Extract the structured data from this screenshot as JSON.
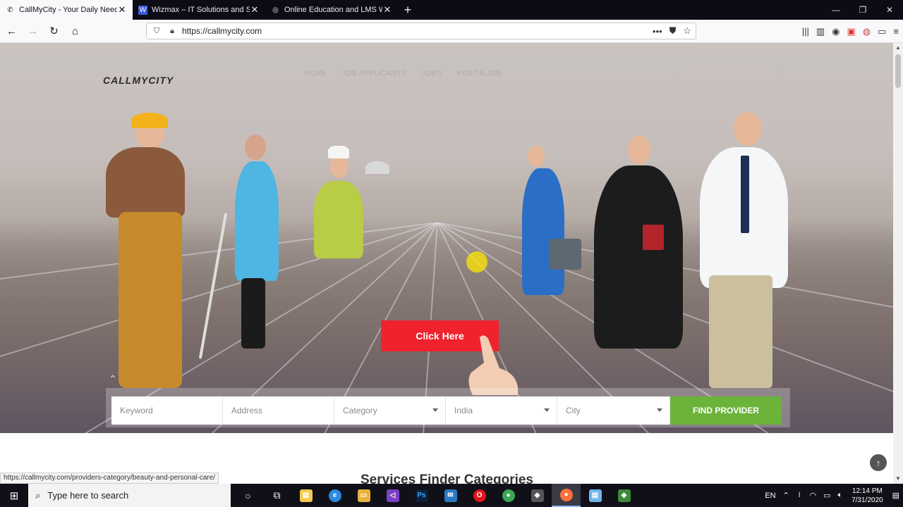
{
  "browser": {
    "tabs": [
      {
        "title": "CallMyCity - Your Daily Needs Fulfi",
        "active": true
      },
      {
        "title": "Wizmax – IT Solutions and Ser",
        "active": false
      },
      {
        "title": "Online Education and LMS Wo",
        "active": false
      }
    ],
    "url": "https://callmycity.com",
    "status_url": "https://callmycity.com/providers-category/beauty-and-personal-care/"
  },
  "site": {
    "logo": "CALLMYCITY",
    "menu": [
      "HOME",
      "JOB APPLICANTS",
      "JOBS",
      "POST A JOB"
    ],
    "hero_button": "Click Here",
    "search": {
      "keyword_placeholder": "Keyword",
      "address_placeholder": "Address",
      "category_value": "Category",
      "country_value": "India",
      "city_value": "City",
      "find_label": "FIND PROVIDER"
    },
    "section_title": "Services Finder Categories"
  },
  "taskbar": {
    "search_placeholder": "Type here to search",
    "language": "EN",
    "time": "12:14 PM",
    "date": "7/31/2020"
  },
  "colors": {
    "accent_red": "#f0222e",
    "accent_green": "#6bb33a"
  }
}
